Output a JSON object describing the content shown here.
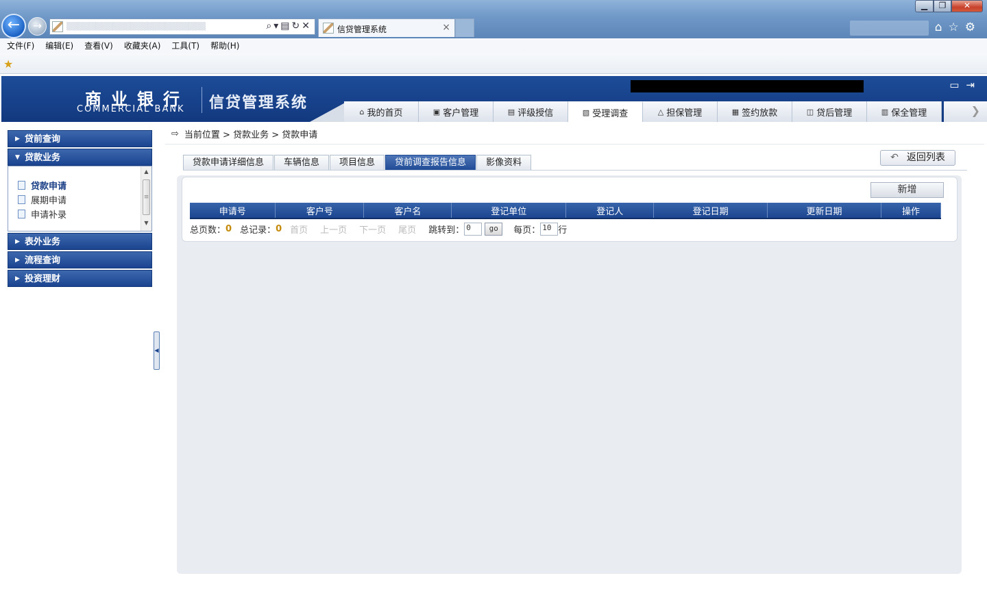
{
  "browser": {
    "tab_title": "信贷管理系统",
    "tab_close": "×",
    "menu": [
      "文件(F)",
      "编辑(E)",
      "查看(V)",
      "收藏夹(A)",
      "工具(T)",
      "帮助(H)"
    ]
  },
  "header": {
    "bank_name_cn": "商业银行",
    "bank_name_en": "COMMERCIAL BANK",
    "system_title": "信贷管理系统"
  },
  "nav": {
    "tabs": [
      {
        "label": "我的首页",
        "icon": "home-icon",
        "glyph": "⌂"
      },
      {
        "label": "客户管理",
        "icon": "customer-icon",
        "glyph": "▣"
      },
      {
        "label": "评级授信",
        "icon": "rating-icon",
        "glyph": "▤"
      },
      {
        "label": "受理调查",
        "icon": "survey-icon",
        "glyph": "▧",
        "active": true
      },
      {
        "label": "担保管理",
        "icon": "guarantee-icon",
        "glyph": "△"
      },
      {
        "label": "签约放款",
        "icon": "contract-icon",
        "glyph": "▦"
      },
      {
        "label": "贷后管理",
        "icon": "post-loan-icon",
        "glyph": "◫"
      },
      {
        "label": "保全管理",
        "icon": "preservation-icon",
        "glyph": "▥"
      }
    ]
  },
  "sidebar": {
    "groups": [
      {
        "label": "贷前查询",
        "expanded": false
      },
      {
        "label": "贷款业务",
        "expanded": true
      },
      {
        "label": "表外业务",
        "expanded": false
      },
      {
        "label": "流程查询",
        "expanded": false
      },
      {
        "label": "投资理财",
        "expanded": false
      }
    ],
    "sub_items": [
      {
        "label": "贷款申请",
        "active": true
      },
      {
        "label": "展期申请",
        "active": false
      },
      {
        "label": "申请补录",
        "active": false
      }
    ]
  },
  "breadcrumb": {
    "text": "当前位置 > 贷款业务 > 贷款申请"
  },
  "sub_tabs": [
    {
      "label": "贷款申请详细信息",
      "active": false
    },
    {
      "label": "车辆信息",
      "active": false
    },
    {
      "label": "项目信息",
      "active": false
    },
    {
      "label": "贷前调查报告信息",
      "active": true
    },
    {
      "label": "影像资料",
      "active": false
    }
  ],
  "buttons": {
    "return_list": "返回列表",
    "add": "新增"
  },
  "table": {
    "columns": [
      "申请号",
      "客户号",
      "客户名",
      "登记单位",
      "登记人",
      "登记日期",
      "更新日期",
      "操作"
    ],
    "rows": []
  },
  "pager": {
    "total_pages_label": "总页数：",
    "total_pages": "0",
    "total_records_label": "总记录：",
    "total_records": "0",
    "first": "首页",
    "prev": "上一页",
    "next": "下一页",
    "last": "尾页",
    "jump_label": "跳转到：",
    "jump_value": "0",
    "go": "go",
    "per_page_label": "每页：",
    "per_page_value": "10",
    "rows_suffix": "行"
  }
}
